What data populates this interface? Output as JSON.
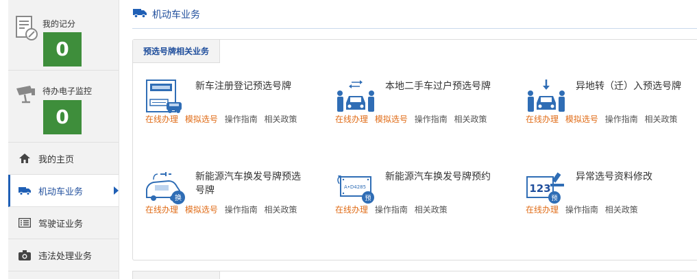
{
  "sidebar": {
    "score_label": "我的记分",
    "score_value": "0",
    "monitor_label": "待办电子监控",
    "monitor_value": "0",
    "items": [
      {
        "label": "我的主页",
        "icon": "home-icon"
      },
      {
        "label": "机动车业务",
        "icon": "car-icon",
        "active": true
      },
      {
        "label": "驾驶证业务",
        "icon": "license-icon"
      },
      {
        "label": "违法处理业务",
        "icon": "camera-icon"
      }
    ]
  },
  "header": {
    "title": "机动车业务",
    "icon": "truck-icon"
  },
  "panel": {
    "tab_label": "预选号牌相关业务",
    "services": [
      {
        "title": "新车注册登记预选号牌",
        "icon": "new-car-plate-icon",
        "links": [
          "在线办理",
          "模拟选号",
          "操作指南",
          "相关政策"
        ]
      },
      {
        "title": "本地二手车过户预选号牌",
        "icon": "used-car-transfer-icon",
        "links": [
          "在线办理",
          "模拟选号",
          "操作指南",
          "相关政策"
        ]
      },
      {
        "title": "异地转（迁）入预选号牌",
        "icon": "transfer-in-icon",
        "links": [
          "在线办理",
          "模拟选号",
          "操作指南",
          "相关政策"
        ]
      },
      {
        "title": "新能源汽车换发号牌预选号牌",
        "icon": "ev-plate-change-icon",
        "badge": "换",
        "links": [
          "在线办理",
          "模拟选号",
          "操作指南",
          "相关政策"
        ]
      },
      {
        "title": "新能源汽车换发号牌预约",
        "icon": "ev-appointment-icon",
        "badge": "预",
        "plate_text": "A•D4285",
        "links": [
          "在线办理",
          "操作指南",
          "相关政策"
        ]
      },
      {
        "title": "异常选号资料修改",
        "icon": "abnormal-edit-icon",
        "badge": "预",
        "plate_text": "123",
        "links": [
          "在线办理",
          "操作指南",
          "相关政策"
        ]
      }
    ]
  },
  "colors": {
    "accent_blue": "#1f5fb5",
    "link_orange": "#e06c17",
    "badge_green": "#3e8e3b"
  }
}
